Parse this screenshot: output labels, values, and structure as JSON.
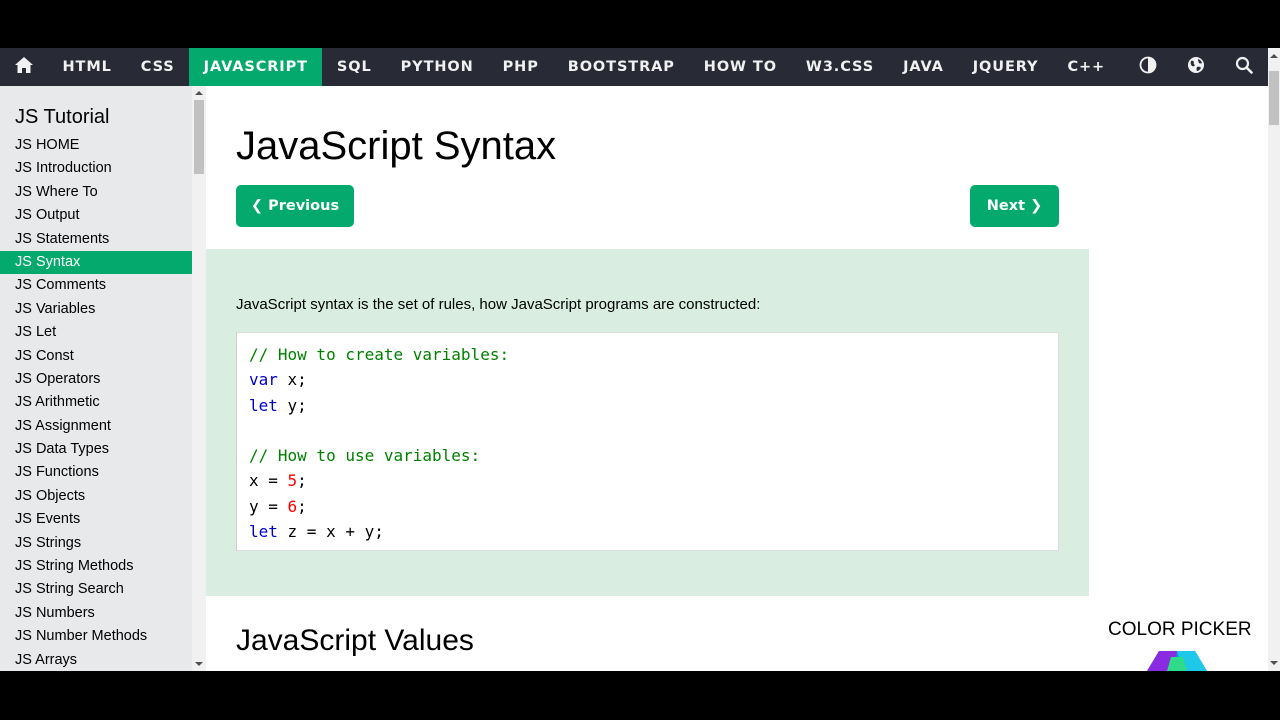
{
  "nav": {
    "items": [
      "HTML",
      "CSS",
      "JAVASCRIPT",
      "SQL",
      "PYTHON",
      "PHP",
      "BOOTSTRAP",
      "HOW TO",
      "W3.CSS",
      "JAVA",
      "JQUERY",
      "C++"
    ],
    "active": "JAVASCRIPT",
    "icons": [
      "home-icon",
      "contrast-icon",
      "globe-icon",
      "search-icon"
    ]
  },
  "sidebar": {
    "title": "JS Tutorial",
    "items": [
      "JS HOME",
      "JS Introduction",
      "JS Where To",
      "JS Output",
      "JS Statements",
      "JS Syntax",
      "JS Comments",
      "JS Variables",
      "JS Let",
      "JS Const",
      "JS Operators",
      "JS Arithmetic",
      "JS Assignment",
      "JS Data Types",
      "JS Functions",
      "JS Objects",
      "JS Events",
      "JS Strings",
      "JS String Methods",
      "JS String Search",
      "JS Numbers",
      "JS Number Methods",
      "JS Arrays"
    ],
    "active": "JS Syntax"
  },
  "main": {
    "title": "JavaScript Syntax",
    "prev_label": "❮ Previous",
    "next_label": "Next ❯",
    "intro": "JavaScript syntax is the set of rules, how JavaScript programs are constructed:",
    "code": {
      "comment1": "// How to create variables:",
      "line1_kw": "var",
      "line1_rest": " x;",
      "line2_kw": "let",
      "line2_rest": " y;",
      "comment2": "// How to use variables:",
      "line3_pre": "x = ",
      "line3_num": "5",
      "line3_post": ";",
      "line4_pre": "y = ",
      "line4_num": "6",
      "line4_post": ";",
      "line5_kw": "let",
      "line5_rest": " z = x + y;"
    },
    "section_title": "JavaScript Values"
  },
  "right": {
    "color_picker_label": "COLOR PICKER"
  },
  "colors": {
    "accent": "#04aa6d",
    "nav_bg": "#282a35",
    "note_bg": "#d9eee1",
    "sidebar_bg": "#e7e9eb"
  }
}
